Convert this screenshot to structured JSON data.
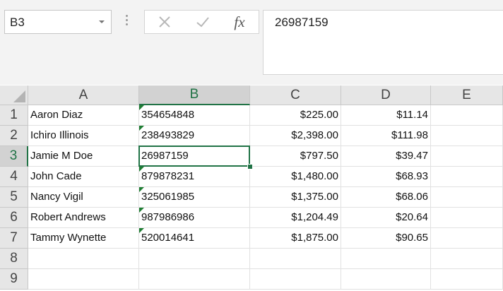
{
  "name_box": "B3",
  "formula_bar": {
    "value": "26987159",
    "fx_label": "fx"
  },
  "columns": [
    "A",
    "B",
    "C",
    "D",
    "E"
  ],
  "selected_column": "B",
  "rows": [
    "1",
    "2",
    "3",
    "4",
    "5",
    "6",
    "7",
    "8",
    "9"
  ],
  "selected_row": "3",
  "data_rows": [
    {
      "name": "Aaron Diaz",
      "id": "354654848",
      "amount": "$225.00",
      "fee": "$11.14"
    },
    {
      "name": "Ichiro Illinois",
      "id": "238493829",
      "amount": "$2,398.00",
      "fee": "$111.98"
    },
    {
      "name": "Jamie M Doe",
      "id": "26987159",
      "amount": "$797.50",
      "fee": "$39.47"
    },
    {
      "name": "John Cade",
      "id": "879878231",
      "amount": "$1,480.00",
      "fee": "$68.93"
    },
    {
      "name": "Nancy Vigil",
      "id": "325061985",
      "amount": "$1,375.00",
      "fee": "$68.06"
    },
    {
      "name": "Robert Andrews",
      "id": "987986986",
      "amount": "$1,204.49",
      "fee": "$20.64"
    },
    {
      "name": "Tammy Wynette",
      "id": "520014641",
      "amount": "$1,875.00",
      "fee": "$90.65"
    }
  ],
  "colors": {
    "accent": "#217346",
    "text_marker": "#1e7d32"
  },
  "icons": {
    "cancel": "close-icon",
    "enter": "check-icon",
    "function": "fx-icon"
  }
}
